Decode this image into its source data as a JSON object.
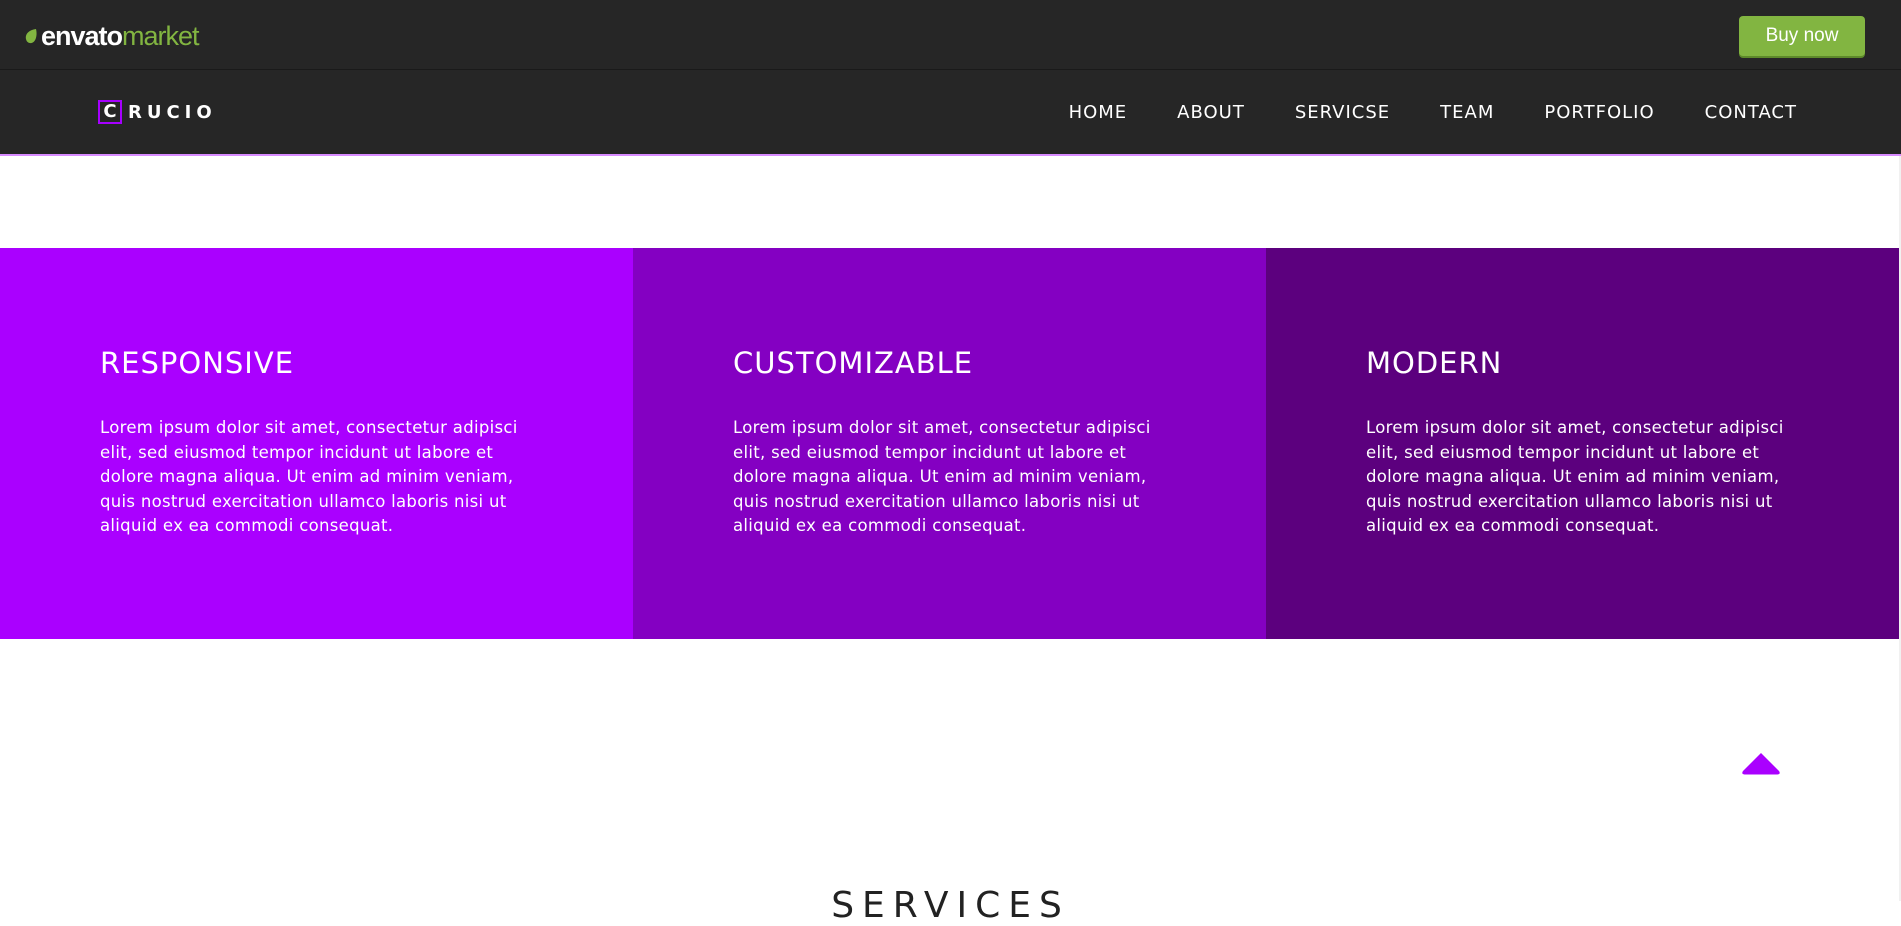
{
  "envato": {
    "brand_text": "envato",
    "market_text": "market",
    "buy_label": "Buy now",
    "colors": {
      "bar": "#262626",
      "accent": "#82b541"
    }
  },
  "site": {
    "logo_letter": "C",
    "logo_rest": "RUCIO",
    "nav": [
      {
        "label": "HOME"
      },
      {
        "label": "ABOUT"
      },
      {
        "label": "SERVICSE"
      },
      {
        "label": "TEAM"
      },
      {
        "label": "PORTFOLIO"
      },
      {
        "label": "CONTACT"
      }
    ],
    "colors": {
      "header": "#262626",
      "accent": "#a600ff"
    }
  },
  "features": [
    {
      "title": "RESPONSIVE",
      "text": "Lorem ipsum dolor sit amet, consectetur adipisci elit, sed eiusmod tempor incidunt ut labore et dolore magna aliqua. Ut enim ad minim veniam, quis nostrud exercitation ullamco laboris nisi ut aliquid ex ea commodi consequat.",
      "color": "#aa00ff"
    },
    {
      "title": "CUSTOMIZABLE",
      "text": "Lorem ipsum dolor sit amet, consectetur adipisci elit, sed eiusmod tempor incidunt ut labore et dolore magna aliqua. Ut enim ad minim veniam, quis nostrud exercitation ullamco laboris nisi ut aliquid ex ea commodi consequat.",
      "color": "#8400c2"
    },
    {
      "title": "MODERN",
      "text": "Lorem ipsum dolor sit amet, consectetur adipisci elit, sed eiusmod tempor incidunt ut labore et dolore magna aliqua. Ut enim ad minim veniam, quis nostrud exercitation ullamco laboris nisi ut aliquid ex ea commodi consequat.",
      "color": "#5c007e"
    }
  ],
  "scroll_top": {
    "icon": "chevron-up-icon",
    "color": "#aa00ff"
  },
  "services": {
    "heading": "SERVICES"
  }
}
